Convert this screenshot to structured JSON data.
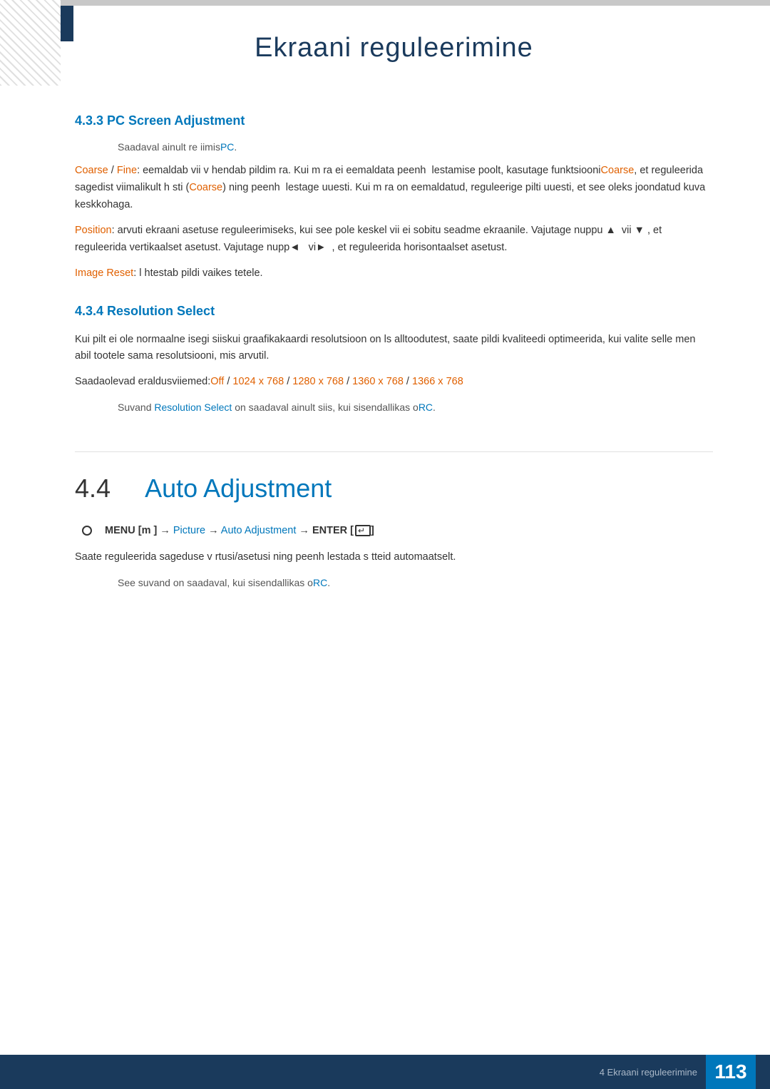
{
  "page": {
    "title": "Ekraani reguleerimine",
    "background_color": "#ffffff"
  },
  "section_4_3_3": {
    "heading": "4.3.3   PC Screen Adjustment",
    "intro": "Saadaval ainult re iimisPC.",
    "coarse_fine_text": "Coarse / Fine: eemaldab vii v hendab pildim ra. Kui m ra ei eemaldata peenh  lestamise poolt, kasutage funktsiooniCoarse, et reguleerida sagedist viimalikult h sti (Coarse) ning peenh  lestage uuesti. Kui m ra on eemaldatud, reguleerige pilti uuesti, et see oleks joondatud kuva keskkohaga.",
    "position_text": "Position: arvuti ekraani asetuse reguleerimiseks, kui see pole keskel vii ei sobitu seadme ekraanile. Vajutage nuppu ▲  vii ▼ , et reguleerida vertikaalset asetust. Vajutage nupp◄   vi►  , et reguleerida horisontaalset asetust.",
    "image_reset_text": "Image Reset: l htestab pildi vaikes tetele."
  },
  "section_4_3_4": {
    "heading": "4.3.4   Resolution Select",
    "body1": "Kui pilt ei ole normaalne isegi siiskui graafikakaardi resolutsioon on  ls alltoodutest, saate pildi kvaliteedi optimeerida, kui valite selle men   abil tootele sama resolutsiooni, mis arvutil.",
    "resolution_label": "Saadaolevad eraldusviiemed:",
    "resolution_options": "Off / 1024 x 768 / 1280 x 768 / 1360 x 768 / 1366 x 768",
    "note": "Suvand Resolution Select on saadaval ainult siis, kui sisendallikas oRC."
  },
  "section_4_4": {
    "heading_number": "4.4",
    "heading_text": "Auto Adjustment",
    "menu_path_prefix": "MENU [",
    "menu_m": "m",
    "menu_path_suffix": " ]",
    "menu_arrow1": "→",
    "menu_picture": "Picture",
    "menu_arrow2": "→",
    "menu_auto": "Auto Adjustment",
    "menu_arrow3": "→",
    "menu_enter": "ENTER [",
    "menu_enter_icon": "↵",
    "menu_enter_suffix": "]",
    "body_text": "Saate reguleerida sageduse v  rtusi/asetusi ning peenh  lestada s tteid automaatselt.",
    "note": "See suvand on saadaval, kui sisendallikas oRC."
  },
  "footer": {
    "section_label": "4 Ekraani reguleerimine",
    "page_number": "113"
  },
  "colors": {
    "orange": "#e06000",
    "blue": "#0077bb",
    "dark_blue": "#1a3a5c",
    "text": "#333333",
    "light_text": "#555555"
  }
}
